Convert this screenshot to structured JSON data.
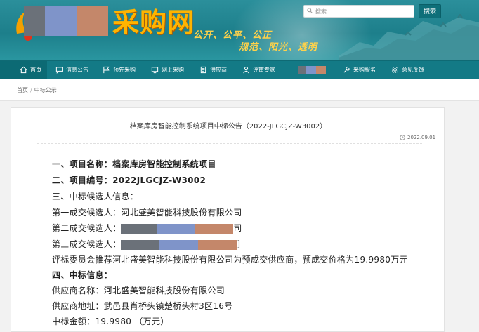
{
  "header": {
    "site_title": "采购网",
    "slogan_line1": "公开、公平、公正",
    "slogan_line2": "规范、阳光、透明",
    "search_placeholder": "搜索",
    "search_button": "搜索"
  },
  "nav": {
    "items": [
      {
        "label": "首页",
        "icon": "home-icon"
      },
      {
        "label": "信息公告",
        "icon": "chat-icon"
      },
      {
        "label": "预先采购",
        "icon": "flag-icon"
      },
      {
        "label": "网上采购",
        "icon": "monitor-icon"
      },
      {
        "label": "供应商",
        "icon": "document-icon"
      },
      {
        "label": "评审专家",
        "icon": "user-icon"
      },
      {
        "label": "采购服务",
        "icon": "wrench-icon"
      },
      {
        "label": "意见反馈",
        "icon": "gear-icon"
      }
    ]
  },
  "breadcrumb": {
    "home": "首页",
    "separator": "/",
    "current": "中标公示"
  },
  "document": {
    "title": "档案库房智能控制系统项目中标公告（2022-JLGCJZ-W3002）",
    "date": "2022.09.01",
    "lines": [
      "一、项目名称：档案库房智能控制系统项目",
      "二、项目编号：2022JLGCJZ-W3002",
      "三、中标候选人信息：",
      "第一成交候选人：河北盛美智能科技股份有限公司",
      "第二成交候选人：",
      "第三成交候选人：",
      "评标委员会推荐河北盛美智能科技股份有限公司为预成交供应商，预成交价格为19.9980万元",
      "四、中标信息：",
      "供应商名称：河北盛美智能科技股份有限公司",
      "供应商地址：武邑县肖桥头镇楚桥头村3区16号",
      "中标金额：19.9980 （万元）"
    ],
    "line2_tail": "司",
    "line3_tail": "]"
  },
  "colors": {
    "header_teal": "#1d7f8b",
    "nav_teal": "#137a86",
    "title_gold": "#ffb400",
    "slogan_yellow": "#ffd24a"
  }
}
